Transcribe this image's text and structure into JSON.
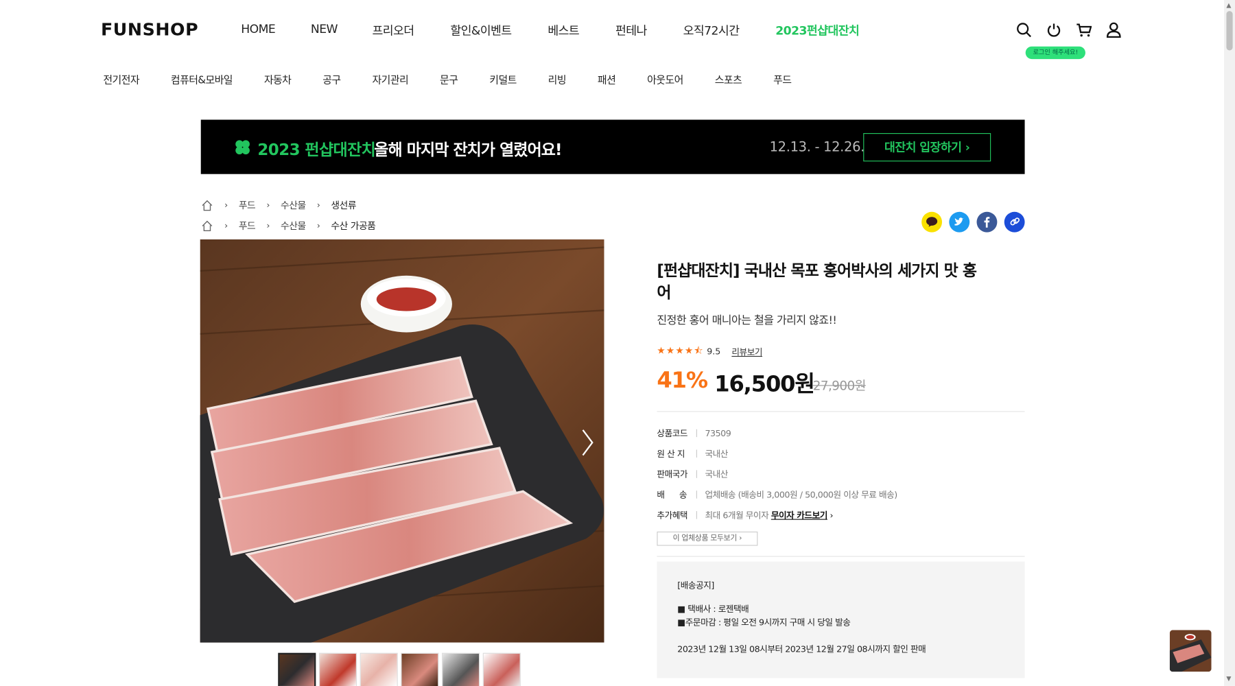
{
  "logo": "FUNSHOP",
  "topnav": [
    "HOME",
    "NEW",
    "프리오더",
    "할인&이벤트",
    "베스트",
    "펀테나",
    "오직72시간",
    "2023펀샵대잔치"
  ],
  "login_hint": "로그인 해주세요!",
  "categories": [
    "전기전자",
    "컴퓨터&모바일",
    "자동차",
    "공구",
    "자기관리",
    "문구",
    "키덜트",
    "리빙",
    "패션",
    "아웃도어",
    "스포츠",
    "푸드"
  ],
  "banner": {
    "event_name": "2023 펀샵대잔치",
    "tagline": "올해 마지막 잔치가 열렸어요!",
    "dates": "12.13. - 12.26.",
    "cta": "대잔치 입장하기 ›"
  },
  "breadcrumbs": [
    [
      "푸드",
      "수산물",
      "생선류"
    ],
    [
      "푸드",
      "수산물",
      "수산 가공품"
    ]
  ],
  "product": {
    "title": "[펀샵대잔치] 국내산 목포 홍어박사의 세가지 맛 홍어",
    "subtitle": "진정한 홍어 매니아는 철을 가리지 않죠!!",
    "stars": "★★★★⯪",
    "rating": "9.5",
    "review_link": "리뷰보기",
    "discount": "41%",
    "price": "16,500원",
    "original_price": "27,900원",
    "info": [
      {
        "label": "상품코드",
        "value": "73509"
      },
      {
        "label": "원 산 지",
        "value": "국내산"
      },
      {
        "label": "판매국가",
        "value": "국내산"
      },
      {
        "label": "배      송",
        "value": "업체배송 (배송비 3,000원 / 50,000원 이상 무료 배송)"
      },
      {
        "label": "추가혜택",
        "value": "최대 6개월 무이자",
        "link": "무이자 카드보기"
      }
    ],
    "all_products_btn": "이 업체상품 모두보기  ›"
  },
  "notice": {
    "heading": "[배송공지]",
    "line1": "■ 택배사 : 로젠택배",
    "line2": "■주문마감 : 평일 오전 9시까지 구매 시 당일 발송",
    "line3": "2023년 12월 13일 08시부터 2023년 12월 27일 08시까지 할인 판매"
  },
  "colors": {
    "accent_green": "#22c55e",
    "discount_orange": "#f97316"
  }
}
